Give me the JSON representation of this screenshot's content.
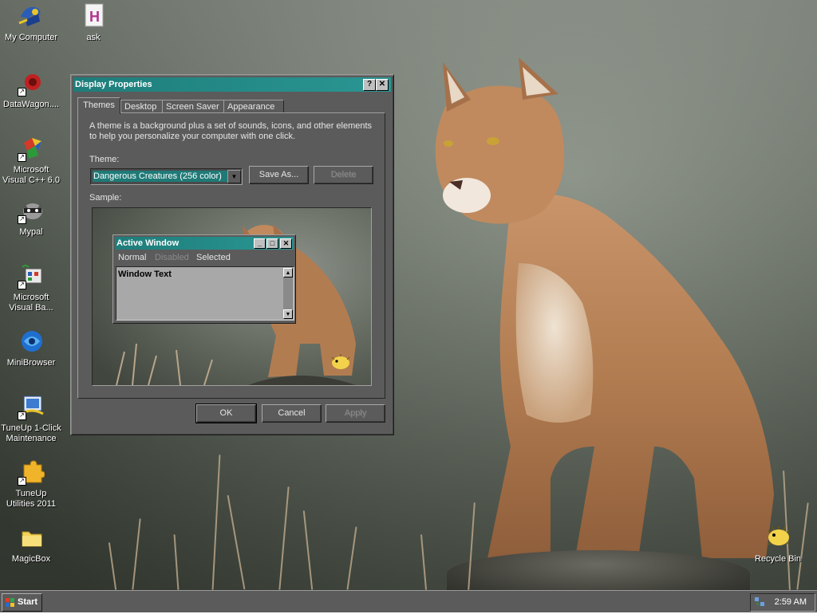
{
  "desktop": {
    "icons": [
      {
        "label": "My Computer",
        "icon": "my-computer-icon"
      },
      {
        "label": "ask",
        "icon": "document-h-icon"
      },
      {
        "label": "DataWagon....",
        "icon": "datawagon-icon"
      },
      {
        "label": "Microsoft Visual C++ 6.0",
        "icon": "visual-cpp-icon"
      },
      {
        "label": "Mypal",
        "icon": "raccoon-icon"
      },
      {
        "label": "Microsoft Visual Ba...",
        "icon": "visual-basic-icon"
      },
      {
        "label": "MiniBrowser",
        "icon": "minibrowser-globe-icon"
      },
      {
        "label": "TuneUp 1-Click Maintenance",
        "icon": "tuneup-monitor-icon"
      },
      {
        "label": "TuneUp Utilities 2011",
        "icon": "tuneup-puzzle-icon"
      },
      {
        "label": "MagicBox",
        "icon": "folder-icon"
      },
      {
        "label": "Recycle Bin",
        "icon": "pufferfish-recycle-icon"
      }
    ]
  },
  "window": {
    "title": "Display Properties",
    "help_glyph": "?",
    "close_glyph": "✕",
    "tabs": [
      "Themes",
      "Desktop",
      "Screen Saver",
      "Appearance"
    ],
    "active_tab": "Themes",
    "description_line1": "A theme is a background plus a set of sounds, icons, and other elements",
    "description_line2": "to help you personalize your computer with one click.",
    "theme_label": "Theme:",
    "theme_value": "Dangerous Creatures (256 color)",
    "save_as_label": "Save As...",
    "delete_label": "Delete",
    "sample_label": "Sample:",
    "ok_label": "OK",
    "cancel_label": "Cancel",
    "apply_label": "Apply"
  },
  "sample": {
    "window_title": "Active Window",
    "menu": [
      "Normal",
      "Disabled",
      "Selected"
    ],
    "window_text": "Window Text"
  },
  "taskbar": {
    "start_label": "Start",
    "clock": "2:59 AM"
  },
  "colors": {
    "title_bar": "#1e7d7a",
    "face": "#5b5b5b",
    "highlight": "#1f7a77"
  }
}
